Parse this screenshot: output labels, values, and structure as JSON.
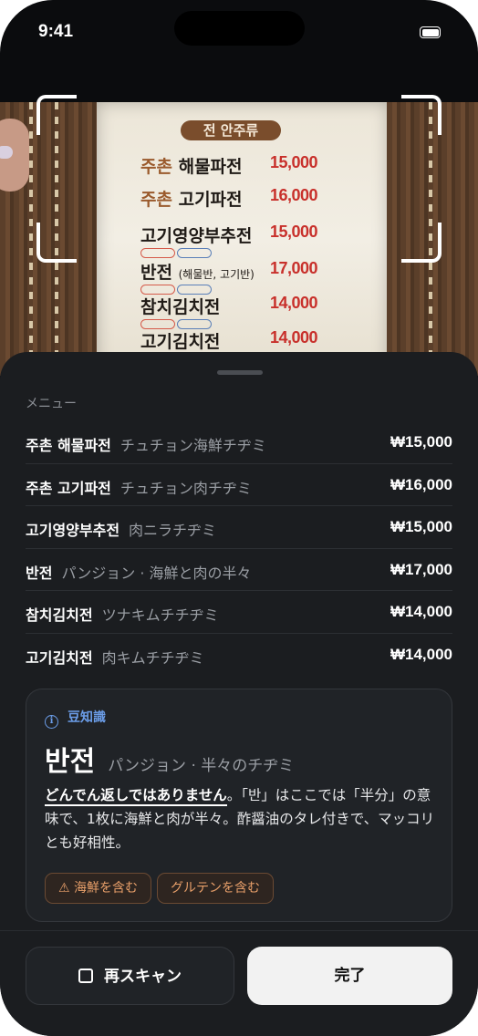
{
  "status_bar": {
    "time": "9:41"
  },
  "camera": {
    "paper_header": "전 안주류",
    "paper_items": [
      {
        "prefix": "주촌",
        "name": "해물파전",
        "price": "15,000"
      },
      {
        "prefix": "주촌",
        "name": "고기파전",
        "price": "16,000"
      },
      {
        "prefix": "",
        "name": "고기영양부추전",
        "price": "15,000"
      },
      {
        "prefix": "",
        "name": "반전",
        "sub": "(해물반, 고기반)",
        "price": "17,000"
      },
      {
        "prefix": "",
        "name": "참치김치전",
        "price": "14,000"
      },
      {
        "prefix": "",
        "name": "고기김치전",
        "price": "14,000"
      }
    ]
  },
  "sheet": {
    "section_label": "メニュー",
    "menu": [
      {
        "ko": "주촌 해물파전",
        "ja": "チュチョン海鮮チヂミ",
        "price": "₩15,000"
      },
      {
        "ko": "주촌 고기파전",
        "ja": "チュチョン肉チヂミ",
        "price": "₩16,000"
      },
      {
        "ko": "고기영양부추전",
        "ja": "肉ニラチヂミ",
        "price": "₩15,000"
      },
      {
        "ko": "반전",
        "ja": "パンジョン · 海鮮と肉の半々",
        "price": "₩17,000"
      },
      {
        "ko": "참치김치전",
        "ja": "ツナキムチチヂミ",
        "price": "₩14,000"
      },
      {
        "ko": "고기김치전",
        "ja": "肉キムチチヂミ",
        "price": "₩14,000"
      }
    ],
    "tip": {
      "heading": "豆知識",
      "title_ko": "반전",
      "title_sub": "パンジョン · 半々のチヂミ",
      "body_strong": "どんでん返しではありません",
      "body_rest": "。「반」はここでは「半分」の意味で、1枚に海鮮と肉が半々。酢醤油のタレ付きで、マッコリとも好相性。",
      "chips": [
        "⚠ 海鮮を含む",
        "グルテンを含む"
      ]
    },
    "buttons": {
      "rescan": "再スキャン",
      "done": "完了"
    }
  }
}
